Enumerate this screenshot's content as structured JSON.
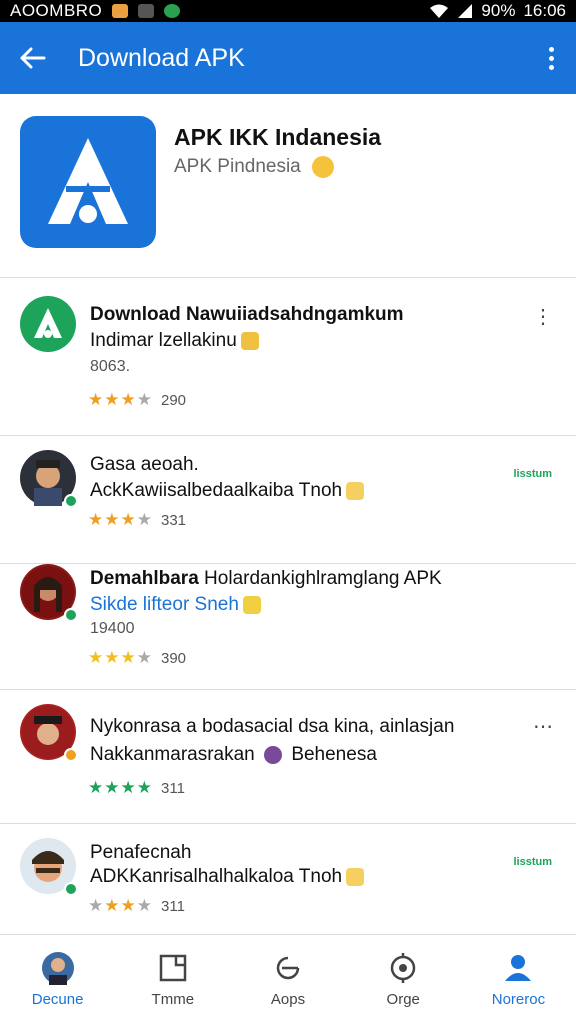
{
  "status_bar": {
    "carrier": "AOOMBRO",
    "battery": "90%",
    "time": "16:06"
  },
  "app_bar": {
    "title": "Download APK"
  },
  "header": {
    "app_name": "APK IKK Indanesia",
    "subtitle": "APK Pindnesia"
  },
  "items": [
    {
      "line1": "Download Nawuiiadsahdngamkum",
      "line2": "Indimar lzellakinu",
      "line3": "8063.",
      "stars": 3,
      "count": "290",
      "star_color": "#f0a020",
      "badge_color": "#1ea35b"
    },
    {
      "line1": "Gasa aeoah.",
      "line2": "AckKawiisalbedaalkaiba Tnoh",
      "stars": 3,
      "count": "331",
      "star_color": "#f0a020",
      "badge_color": "#1ea35b",
      "tag": "lisstum"
    },
    {
      "line1_bold": "Demahlbara",
      "line1_rest": " Holardankighlramglang APK",
      "line2": "Sikde lifteor Sneh",
      "line3": "19400",
      "stars": 3,
      "count": "390",
      "star_color": "#f0c020",
      "badge_color": "#1ea35b"
    },
    {
      "line1": "Nykonrasa a bodasacial dsa kina, ainlasjan",
      "line2": "Nakkanmarasrakan",
      "line2_suffix": "Behenesa",
      "stars": 4,
      "count": "311",
      "star_color": "#1ea35b",
      "badge_color": "#f0a020"
    },
    {
      "line1": "Penafecnah",
      "line2": "ADKKanrisalhalhalkaloa Tnoh",
      "stars": 3,
      "count": "311",
      "star_color": "#f0a020",
      "badge_color": "#1ea35b",
      "tag": "lisstum"
    }
  ],
  "bottom_nav": [
    {
      "label": "Decune",
      "icon": "avatar-icon"
    },
    {
      "label": "Tmme",
      "icon": "window-icon"
    },
    {
      "label": "Aops",
      "icon": "refresh-icon"
    },
    {
      "label": "Orge",
      "icon": "target-icon"
    },
    {
      "label": "Noreroc",
      "icon": "person-icon"
    }
  ],
  "colors": {
    "primary": "#1a73d9",
    "green": "#1ea35b",
    "gold": "#f0a020"
  }
}
